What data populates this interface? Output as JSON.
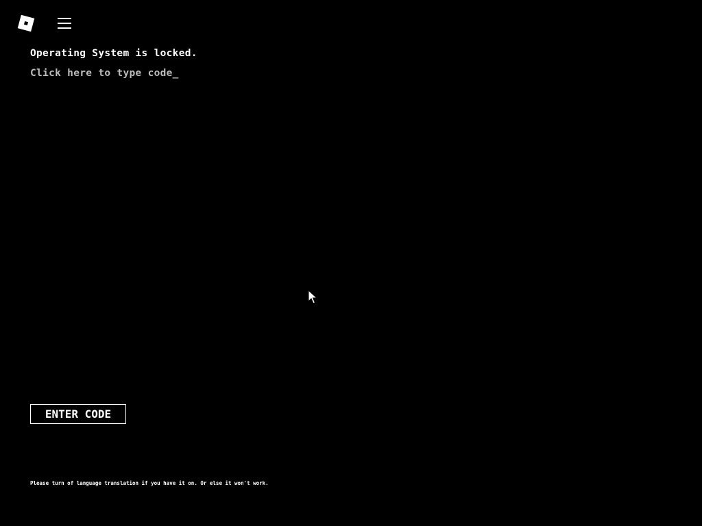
{
  "topbar": {
    "logo_icon": "roblox-logo-icon",
    "menu_icon": "hamburger-menu-icon"
  },
  "terminal": {
    "title": "Operating System is locked.",
    "input_prompt": "Click here to type code_"
  },
  "actions": {
    "enter_label": "ENTER CODE"
  },
  "footer": {
    "note": "Please turn of language translation if you have it on. Or else it won't work."
  },
  "pointer": {
    "icon": "mouse-pointer-icon"
  },
  "colors": {
    "background": "#000000",
    "text": "#ffffff",
    "prompt_text": "#bdbdbd"
  }
}
